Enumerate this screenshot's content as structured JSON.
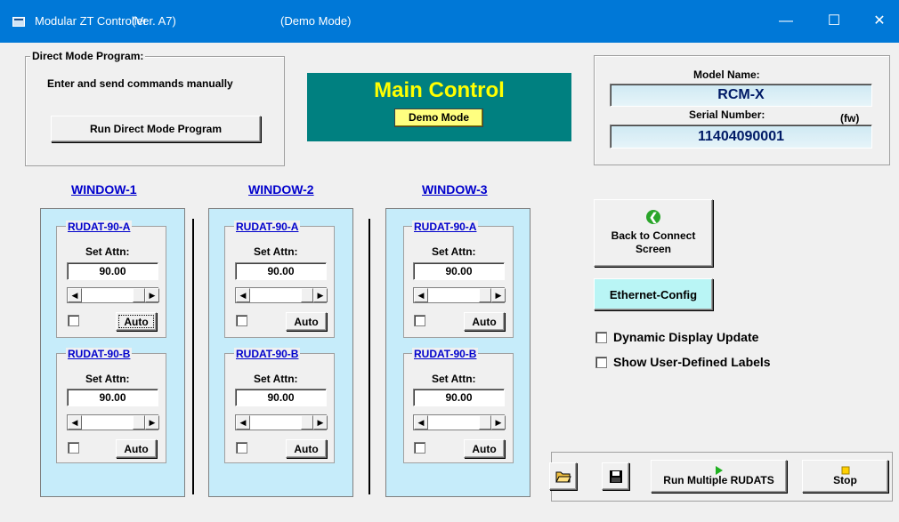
{
  "titlebar": {
    "app_title": "Modular ZT Controller",
    "version": "(Ver. A7)",
    "mode": "(Demo Mode)",
    "minimize_glyph": "—",
    "maximize_glyph": "☐",
    "close_glyph": "✕"
  },
  "direct_mode": {
    "legend": "Direct Mode Program:",
    "instruction": "Enter and send commands manually",
    "button": "Run Direct Mode Program"
  },
  "main_control": {
    "title": "Main Control",
    "badge": "Demo Mode",
    "accent": "#008080",
    "title_color": "#ffff00"
  },
  "model_info": {
    "model_label": "Model Name:",
    "model_value": "RCM-X",
    "serial_label": "Serial Number:",
    "fw_label": "(fw)",
    "serial_value": "11404090001"
  },
  "windows": [
    {
      "title": "WINDOW-1",
      "channels": [
        {
          "name": "RUDAT-90-A",
          "set_label": "Set Attn:",
          "value": "90.00",
          "auto": "Auto",
          "checked": false
        },
        {
          "name": "RUDAT-90-B",
          "set_label": "Set Attn:",
          "value": "90.00",
          "auto": "Auto",
          "checked": false
        }
      ]
    },
    {
      "title": "WINDOW-2",
      "channels": [
        {
          "name": "RUDAT-90-A",
          "set_label": "Set Attn:",
          "value": "90.00",
          "auto": "Auto",
          "checked": false
        },
        {
          "name": "RUDAT-90-B",
          "set_label": "Set Attn:",
          "value": "90.00",
          "auto": "Auto",
          "checked": false
        }
      ]
    },
    {
      "title": "WINDOW-3",
      "channels": [
        {
          "name": "RUDAT-90-A",
          "set_label": "Set Attn:",
          "value": "90.00",
          "auto": "Auto",
          "checked": false
        },
        {
          "name": "RUDAT-90-B",
          "set_label": "Set Attn:",
          "value": "90.00",
          "auto": "Auto",
          "checked": false
        }
      ]
    }
  ],
  "actions": {
    "back_line1": "Back to Connect",
    "back_line2": "Screen",
    "ethernet": "Ethernet-Config",
    "dynamic_update": "Dynamic Display Update",
    "user_labels": "Show User-Defined Labels"
  },
  "toolbar": {
    "run_multiple": "Run Multiple RUDATS",
    "stop": "Stop",
    "open_icon": "open-folder-icon",
    "save_icon": "floppy-disk-icon"
  }
}
